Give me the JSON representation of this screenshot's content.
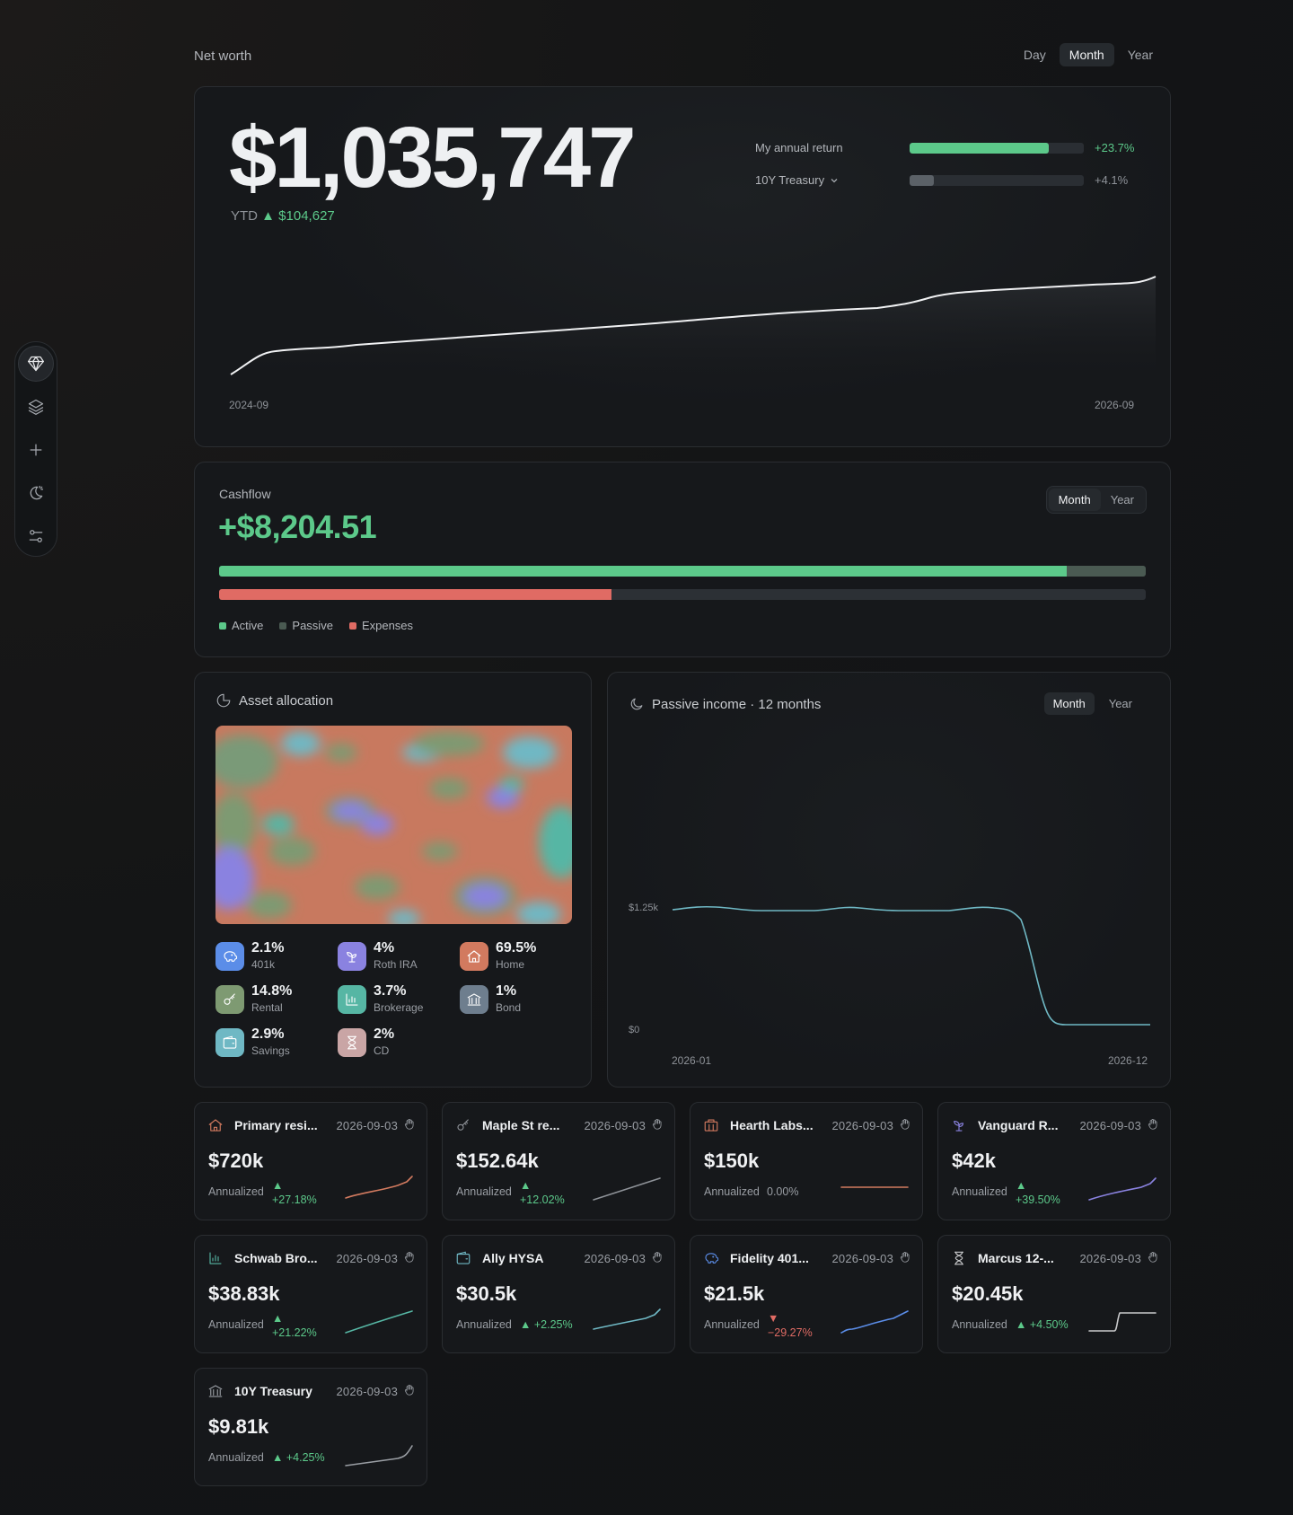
{
  "page": {
    "title": "Net worth",
    "range_tabs": [
      "Day",
      "Month",
      "Year"
    ],
    "range_selected": "Month"
  },
  "sidebar": {
    "icons": [
      "diamond-icon",
      "layers-icon",
      "plus-icon",
      "theme-icon",
      "settings-sliders-icon"
    ]
  },
  "net_worth": {
    "value": "$1,035,747",
    "ytd_label": "YTD",
    "ytd_change": "▲ $104,627",
    "returns": [
      {
        "label": "My annual return",
        "value": "+23.7%",
        "fill": 0.8,
        "color": "#5cc98a"
      },
      {
        "label": "10Y Treasury",
        "value": "+4.1%",
        "fill": 0.14,
        "color": "#5b6167"
      }
    ],
    "x_start": "2024-09",
    "x_end": "2026-09"
  },
  "cashflow": {
    "label": "Cashflow",
    "value": "+$8,204.51",
    "tabs": [
      "Month",
      "Year"
    ],
    "selected": "Month",
    "active_share": 0.915,
    "passive_share": 0.085,
    "expenses_share": 0.423,
    "legend": [
      {
        "label": "Active",
        "color": "#5cc98a"
      },
      {
        "label": "Passive",
        "color": "#4a5a52"
      },
      {
        "label": "Expenses",
        "color": "#e06b64"
      }
    ]
  },
  "asset_allocation": {
    "title": "Asset allocation",
    "items": [
      {
        "pct": "2.1%",
        "name": "401k",
        "color": "#5b8de8",
        "icon": "piggy-bank-icon"
      },
      {
        "pct": "4%",
        "name": "Roth IRA",
        "color": "#8a82e0",
        "icon": "sprout-icon"
      },
      {
        "pct": "69.5%",
        "name": "Home",
        "color": "#d27a5f",
        "icon": "home-icon"
      },
      {
        "pct": "14.8%",
        "name": "Rental",
        "color": "#7e9a72",
        "icon": "key-icon"
      },
      {
        "pct": "3.7%",
        "name": "Brokerage",
        "color": "#56b6a4",
        "icon": "chart-icon"
      },
      {
        "pct": "1%",
        "name": "Bond",
        "color": "#6e7e8e",
        "icon": "bank-icon"
      },
      {
        "pct": "2.9%",
        "name": "Savings",
        "color": "#6fb8c4",
        "icon": "wallet-icon"
      },
      {
        "pct": "2%",
        "name": "CD",
        "color": "#c9a5a5",
        "icon": "hourglass-icon"
      }
    ]
  },
  "passive_income": {
    "title": "Passive income · 12 months",
    "tabs": [
      "Month",
      "Year"
    ],
    "selected": "Month",
    "y_labels": [
      "$1.25k",
      "$0"
    ],
    "x_start": "2026-01",
    "x_end": "2026-12"
  },
  "holdings": [
    {
      "name": "Primary resi...",
      "date": "2026-09-03",
      "value": "$720k",
      "ann_label": "Annualized",
      "change": "+27.18%",
      "dir": "up",
      "color": "#d27a5f",
      "icon": "home-icon"
    },
    {
      "name": "Maple St re...",
      "date": "2026-09-03",
      "value": "$152.64k",
      "ann_label": "Annualized",
      "change": "+12.02%",
      "dir": "up",
      "color": "#8e9298",
      "icon": "key-icon"
    },
    {
      "name": "Hearth Labs...",
      "date": "2026-09-03",
      "value": "$150k",
      "ann_label": "Annualized",
      "change": "0.00%",
      "dir": "flat",
      "color": "#d27a5f",
      "icon": "building-icon"
    },
    {
      "name": "Vanguard R...",
      "date": "2026-09-03",
      "value": "$42k",
      "ann_label": "Annualized",
      "change": "+39.50%",
      "dir": "up",
      "color": "#8a82e0",
      "icon": "sprout-icon"
    },
    {
      "name": "Schwab Bro...",
      "date": "2026-09-03",
      "value": "$38.83k",
      "ann_label": "Annualized",
      "change": "+21.22%",
      "dir": "up",
      "color": "#56b6a4",
      "icon": "chart-icon"
    },
    {
      "name": "Ally HYSA",
      "date": "2026-09-03",
      "value": "$30.5k",
      "ann_label": "Annualized",
      "change": "+2.25%",
      "dir": "up",
      "color": "#6fb8c4",
      "icon": "wallet-icon"
    },
    {
      "name": "Fidelity 401...",
      "date": "2026-09-03",
      "value": "$21.5k",
      "ann_label": "Annualized",
      "change": "−29.27%",
      "dir": "down",
      "color": "#5b8de8",
      "icon": "piggy-bank-icon"
    },
    {
      "name": "Marcus 12-...",
      "date": "2026-09-03",
      "value": "$20.45k",
      "ann_label": "Annualized",
      "change": "+4.50%",
      "dir": "up",
      "color": "#c8c9cb",
      "icon": "hourglass-icon"
    },
    {
      "name": "10Y Treasury",
      "date": "2026-09-03",
      "value": "$9.81k",
      "ann_label": "Annualized",
      "change": "+4.25%",
      "dir": "up",
      "color": "#9a9ea4",
      "icon": "bank-icon"
    }
  ]
}
